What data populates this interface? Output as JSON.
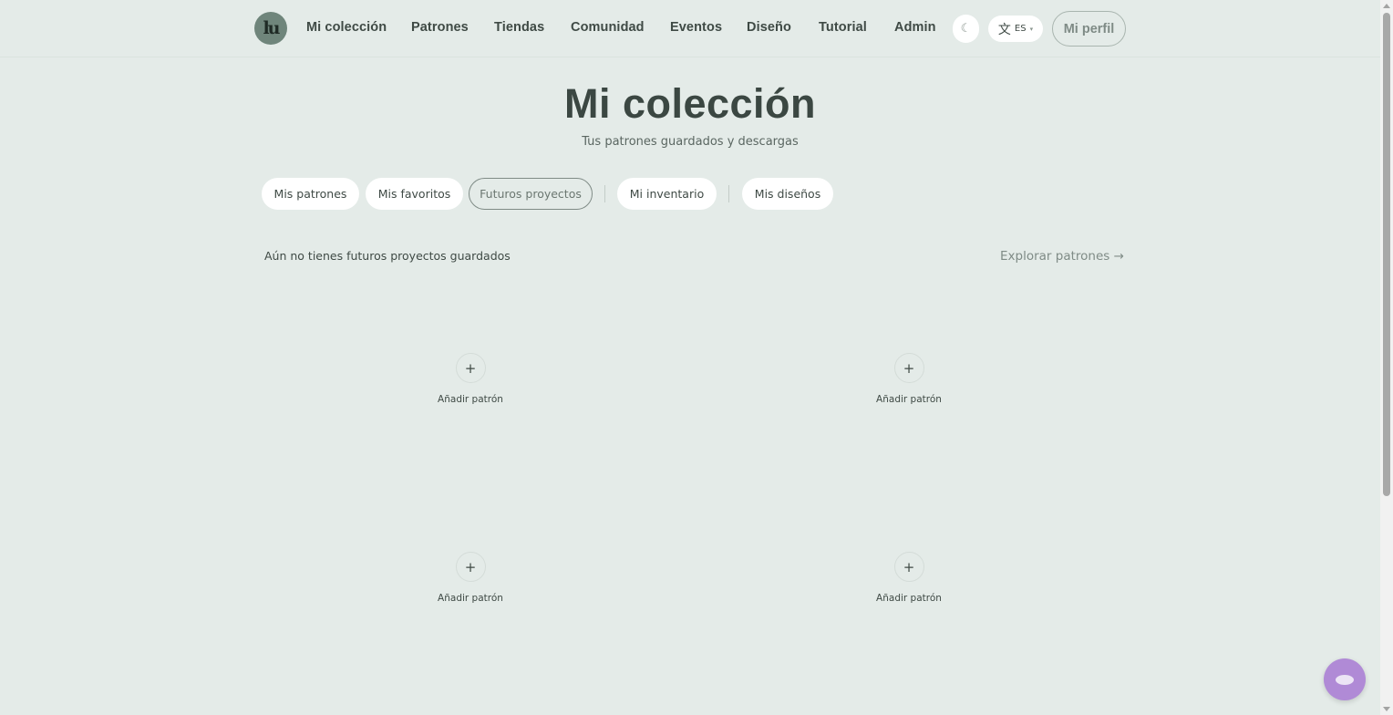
{
  "nav": {
    "logo_text": "lu",
    "items": [
      "Mi colección",
      "Patrones",
      "Tiendas",
      "Comunidad",
      "Eventos",
      "Diseño",
      "Tutorial",
      "Admin"
    ],
    "theme_icon": "☾",
    "language": "ES",
    "profile_label": "Mi perfil"
  },
  "header": {
    "title": "Mi colección",
    "subtitle": "Tus patrones guardados y descargas"
  },
  "tabs": [
    {
      "label": "Mis patrones",
      "active": false
    },
    {
      "label": "Mis favoritos",
      "active": false
    },
    {
      "label": "Futuros proyectos",
      "active": true
    },
    {
      "label": "Mi inventario",
      "active": false
    },
    {
      "label": "Mis diseños",
      "active": false
    }
  ],
  "main": {
    "empty_message": "Aún no tienes futuros proyectos guardados",
    "explore_link": "Explorar patrones →",
    "slots": [
      {
        "plus": "+",
        "label": "Añadir patrón"
      },
      {
        "plus": "+",
        "label": "Añadir patrón"
      },
      {
        "plus": "+",
        "label": "Añadir patrón"
      },
      {
        "plus": "+",
        "label": "Añadir patrón"
      }
    ]
  },
  "colors": {
    "background": "#e4ebe8",
    "text": "#3f4a45",
    "accent_muted": "#7f8b86",
    "chat_button": "#b08ad6"
  },
  "icons": {
    "logo": "logo-icon",
    "theme": "moon-icon",
    "language": "translate-icon",
    "chat": "chat-icon"
  }
}
